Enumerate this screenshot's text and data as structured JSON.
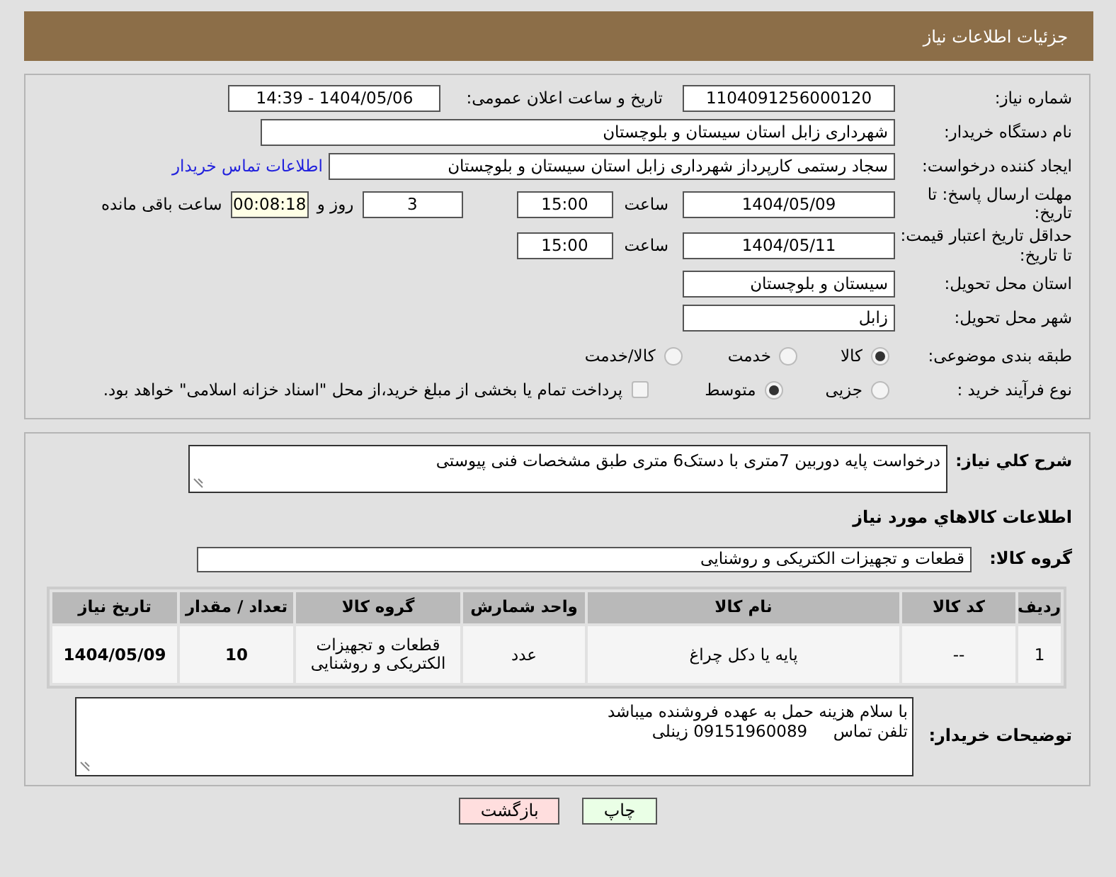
{
  "header": {
    "title": "جزئیات اطلاعات نیاز"
  },
  "need_number": {
    "label": "شماره نیاز:",
    "value": "1104091256000120"
  },
  "announce": {
    "label": "تاریخ و ساعت اعلان عمومی:",
    "value": "1404/05/06 - 14:39"
  },
  "buyer_org": {
    "label": "نام دستگاه خریدار:",
    "value": "شهرداری زابل استان سیستان و بلوچستان"
  },
  "requester": {
    "label": "ایجاد کننده درخواست:",
    "value": "سجاد رستمی کارپرداز شهرداری زابل استان سیستان و بلوچستان",
    "link": "اطلاعات تماس خریدار"
  },
  "deadline": {
    "label": "مهلت ارسال پاسخ: تا تاریخ:",
    "date": "1404/05/09",
    "time_label": "ساعت",
    "time": "15:00",
    "days": "3",
    "days_label": "روز و",
    "remaining": "00:08:18",
    "remaining_label": "ساعت باقی مانده"
  },
  "validity": {
    "label": "حداقل تاریخ اعتبار قیمت: تا تاریخ:",
    "date": "1404/05/11",
    "time_label": "ساعت",
    "time": "15:00"
  },
  "province": {
    "label": "استان محل تحویل:",
    "value": "سیستان و بلوچستان"
  },
  "city": {
    "label": "شهر محل تحویل:",
    "value": "زابل"
  },
  "category": {
    "label": "طبقه بندی موضوعی:",
    "options": [
      {
        "label": "کالا",
        "selected": true
      },
      {
        "label": "خدمت",
        "selected": false
      },
      {
        "label": "کالا/خدمت",
        "selected": false
      }
    ]
  },
  "process": {
    "label": "نوع فرآیند خرید :",
    "options": [
      {
        "label": "جزیی",
        "selected": false
      },
      {
        "label": "متوسط",
        "selected": true
      }
    ],
    "payment": {
      "label": "پرداخت تمام یا بخشی از مبلغ خرید،از محل \"اسناد خزانه اسلامی\" خواهد بود.",
      "checked": false
    }
  },
  "description": {
    "label": "شرح كلي نياز:",
    "value": "درخواست پایه دوربین 7متری با دستک6 متری طبق مشخصات فنی پیوستی"
  },
  "goods_title": "اطلاعات كالاهاي مورد نياز",
  "goods_group": {
    "label": "گروه كالا:",
    "value": "قطعات و تجهیزات الکتریکی و روشنایی"
  },
  "table": {
    "columns": [
      "ردیف",
      "کد کالا",
      "نام کالا",
      "واحد شمارش",
      "گروه کالا",
      "تعداد / مقدار",
      "تاریخ نیاز"
    ],
    "rows": [
      [
        "1",
        "--",
        "پایه یا دکل چراغ",
        "عدد",
        "قطعات و تجهیزات الکتریکی و روشنایی",
        "10",
        "1404/05/09"
      ]
    ]
  },
  "buyer_notes": {
    "label": "توضیحات خریدار:",
    "lines": [
      "با سلام هزینه حمل به عهده فروشنده میباشد",
      "تلفن تماس     09151960089 زینلی"
    ]
  },
  "buttons": [
    {
      "label": "چاپ",
      "kind": "print"
    },
    {
      "label": "بازگشت",
      "kind": "back"
    }
  ]
}
